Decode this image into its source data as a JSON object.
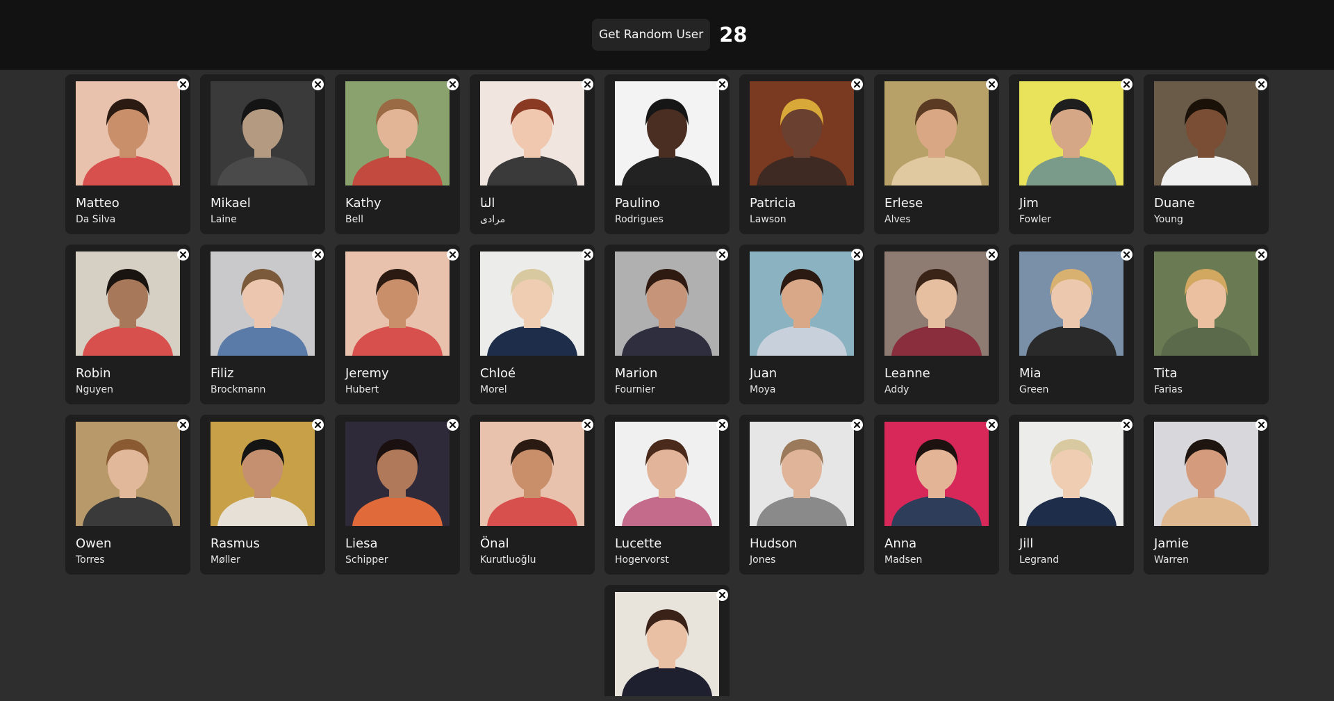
{
  "header": {
    "button_label": "Get Random User",
    "count": "28"
  },
  "icons": {
    "close": "close-icon",
    "avatar": "avatar-photo"
  },
  "users": [
    {
      "first": "Matteo",
      "last": "Da Silva",
      "bg": "#e9c2ad",
      "skin": "#c98f6b",
      "hair": "#2a1a12",
      "shirt": "#d8504e"
    },
    {
      "first": "Mikael",
      "last": "Laine",
      "bg": "#3a3a3a",
      "skin": "#b49a80",
      "hair": "#141414",
      "shirt": "#4a4a4a"
    },
    {
      "first": "Kathy",
      "last": "Bell",
      "bg": "#8aa36e",
      "skin": "#e2b597",
      "hair": "#9a6a45",
      "shirt": "#c24a3e"
    },
    {
      "first": "النا",
      "last": "مرادی",
      "bg": "#f1e6df",
      "skin": "#f0c8b0",
      "hair": "#8a3a22",
      "shirt": "#3a3a3a"
    },
    {
      "first": "Paulino",
      "last": "Rodrigues",
      "bg": "#f3f3f3",
      "skin": "#4a2e22",
      "hair": "#161616",
      "shirt": "#222222"
    },
    {
      "first": "Patricia",
      "last": "Lawson",
      "bg": "#7a3a22",
      "skin": "#6a4030",
      "hair": "#d8a838",
      "shirt": "#3e2a22"
    },
    {
      "first": "Erlese",
      "last": "Alves",
      "bg": "#b8a168",
      "skin": "#d9a783",
      "hair": "#5a3a22",
      "shirt": "#e0c9a0"
    },
    {
      "first": "Jim",
      "last": "Fowler",
      "bg": "#e8e35a",
      "skin": "#d6a787",
      "hair": "#1e1e1e",
      "shirt": "#7a9a8a"
    },
    {
      "first": "Duane",
      "last": "Young",
      "bg": "#6a5a48",
      "skin": "#7a4e34",
      "hair": "#1a1208",
      "shirt": "#f0f0f0"
    },
    {
      "first": "Robin",
      "last": "Nguyen",
      "bg": "#d6d0c4",
      "skin": "#a8785a",
      "hair": "#1a1410",
      "shirt": "#d8504e"
    },
    {
      "first": "Filiz",
      "last": "Brockmann",
      "bg": "#c9c9cc",
      "skin": "#ecc6ae",
      "hair": "#7a5a3a",
      "shirt": "#5a7aa8"
    },
    {
      "first": "Jeremy",
      "last": "Hubert",
      "bg": "#e9c2ad",
      "skin": "#c98f6b",
      "hair": "#2a1a12",
      "shirt": "#d8504e"
    },
    {
      "first": "Chloé",
      "last": "Morel",
      "bg": "#ececea",
      "skin": "#efcdb2",
      "hair": "#d9c9a0",
      "shirt": "#1e2e4a"
    },
    {
      "first": "Marion",
      "last": "Fournier",
      "bg": "#b0b0b0",
      "skin": "#c69478",
      "hair": "#2e1a10",
      "shirt": "#2e2e3e"
    },
    {
      "first": "Juan",
      "last": "Moya",
      "bg": "#8ab2c0",
      "skin": "#d8a888",
      "hair": "#2a1a12",
      "shirt": "#c8d0dc"
    },
    {
      "first": "Leanne",
      "last": "Addy",
      "bg": "#8e7b72",
      "skin": "#e6bea0",
      "hair": "#3a2418",
      "shirt": "#8a2e3e"
    },
    {
      "first": "Mia",
      "last": "Green",
      "bg": "#7a90a8",
      "skin": "#ecc9ae",
      "hair": "#d8b070",
      "shirt": "#2a2a2a"
    },
    {
      "first": "Tita",
      "last": "Farias",
      "bg": "#6a7a52",
      "skin": "#eac0a0",
      "hair": "#d2a860",
      "shirt": "#5a6a4a"
    },
    {
      "first": "Owen",
      "last": "Torres",
      "bg": "#b89a6a",
      "skin": "#e2b89a",
      "hair": "#8a5a32",
      "shirt": "#3a3a3a"
    },
    {
      "first": "Rasmus",
      "last": "Møller",
      "bg": "#c8a048",
      "skin": "#c49070",
      "hair": "#141414",
      "shirt": "#e6e0d6"
    },
    {
      "first": "Liesa",
      "last": "Schipper",
      "bg": "#2e2a3a",
      "skin": "#b07a5a",
      "hair": "#1a1010",
      "shirt": "#e06a3a"
    },
    {
      "first": "Önal",
      "last": "Kurutluoğlu",
      "bg": "#e9c2ad",
      "skin": "#c98f6b",
      "hair": "#2a1a12",
      "shirt": "#d8504e"
    },
    {
      "first": "Lucette",
      "last": "Hogervorst",
      "bg": "#f0f0f0",
      "skin": "#e2b49a",
      "hair": "#4a2a1a",
      "shirt": "#c46a8a"
    },
    {
      "first": "Hudson",
      "last": "Jones",
      "bg": "#e6e6e6",
      "skin": "#e0b498",
      "hair": "#9a7a5a",
      "shirt": "#8a8a8a"
    },
    {
      "first": "Anna",
      "last": "Madsen",
      "bg": "#d8285a",
      "skin": "#e4b496",
      "hair": "#1e1210",
      "shirt": "#2e3e5a"
    },
    {
      "first": "Jill",
      "last": "Legrand",
      "bg": "#ececea",
      "skin": "#efcdb2",
      "hair": "#d9c9a0",
      "shirt": "#1e2e4a"
    },
    {
      "first": "Jamie",
      "last": "Warren",
      "bg": "#d8d8dc",
      "skin": "#d49c7c",
      "hair": "#1e1410",
      "shirt": "#e0b890"
    },
    {
      "first": "",
      "last": "",
      "bg": "#e8e4dc",
      "skin": "#eac0a4",
      "hair": "#3a2218",
      "shirt": "#1e2030"
    }
  ]
}
